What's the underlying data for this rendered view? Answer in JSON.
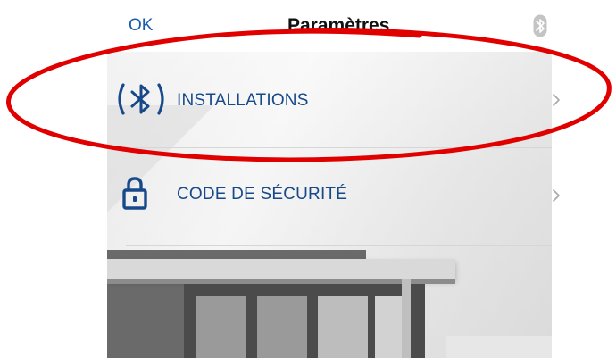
{
  "header": {
    "ok_label": "OK",
    "title": "Paramètres",
    "status_icon": "bluetooth-icon"
  },
  "menu": {
    "items": [
      {
        "label": "INSTALLATIONS",
        "icon": "bluetooth-wave-icon",
        "chevron": "chevron-right-icon"
      },
      {
        "label": "CODE DE SÉCURITÉ",
        "icon": "lock-icon",
        "chevron": "chevron-right-icon"
      }
    ]
  },
  "colors": {
    "accent": "#17498a",
    "annotation": "#e00000",
    "title": "#111111"
  }
}
